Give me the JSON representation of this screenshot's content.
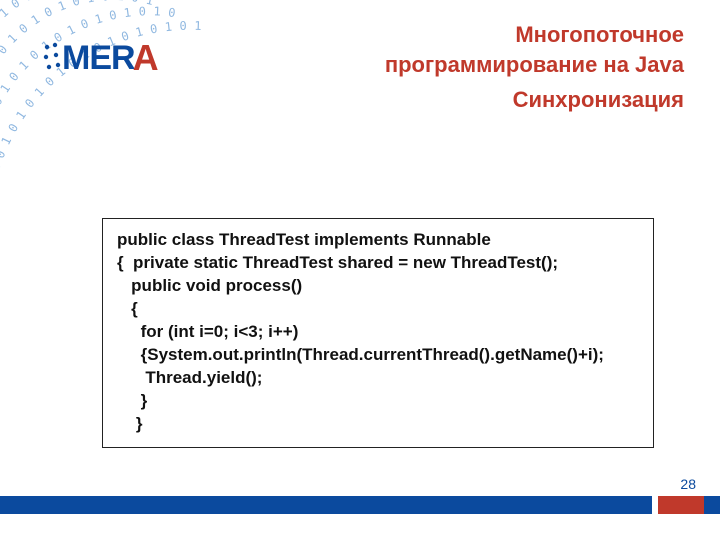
{
  "logo": {
    "text": "MER",
    "accent": "A"
  },
  "headings": {
    "line1": "Многопоточное",
    "line2": "программирование на Java",
    "line3": "Синхронизация"
  },
  "code": {
    "l0": "public class ThreadTest implements Runnable",
    "l1": "{  private static ThreadTest shared = new ThreadTest();",
    "l2": "   public void process()",
    "l3": "   {",
    "l4": "     for (int i=0; i<3; i++)",
    "l5": "     {System.out.println(Thread.currentThread().getName()+i);",
    "l6": "      Thread.yield();",
    "l7": "     }",
    "l8": "    }"
  },
  "page_number": "28"
}
